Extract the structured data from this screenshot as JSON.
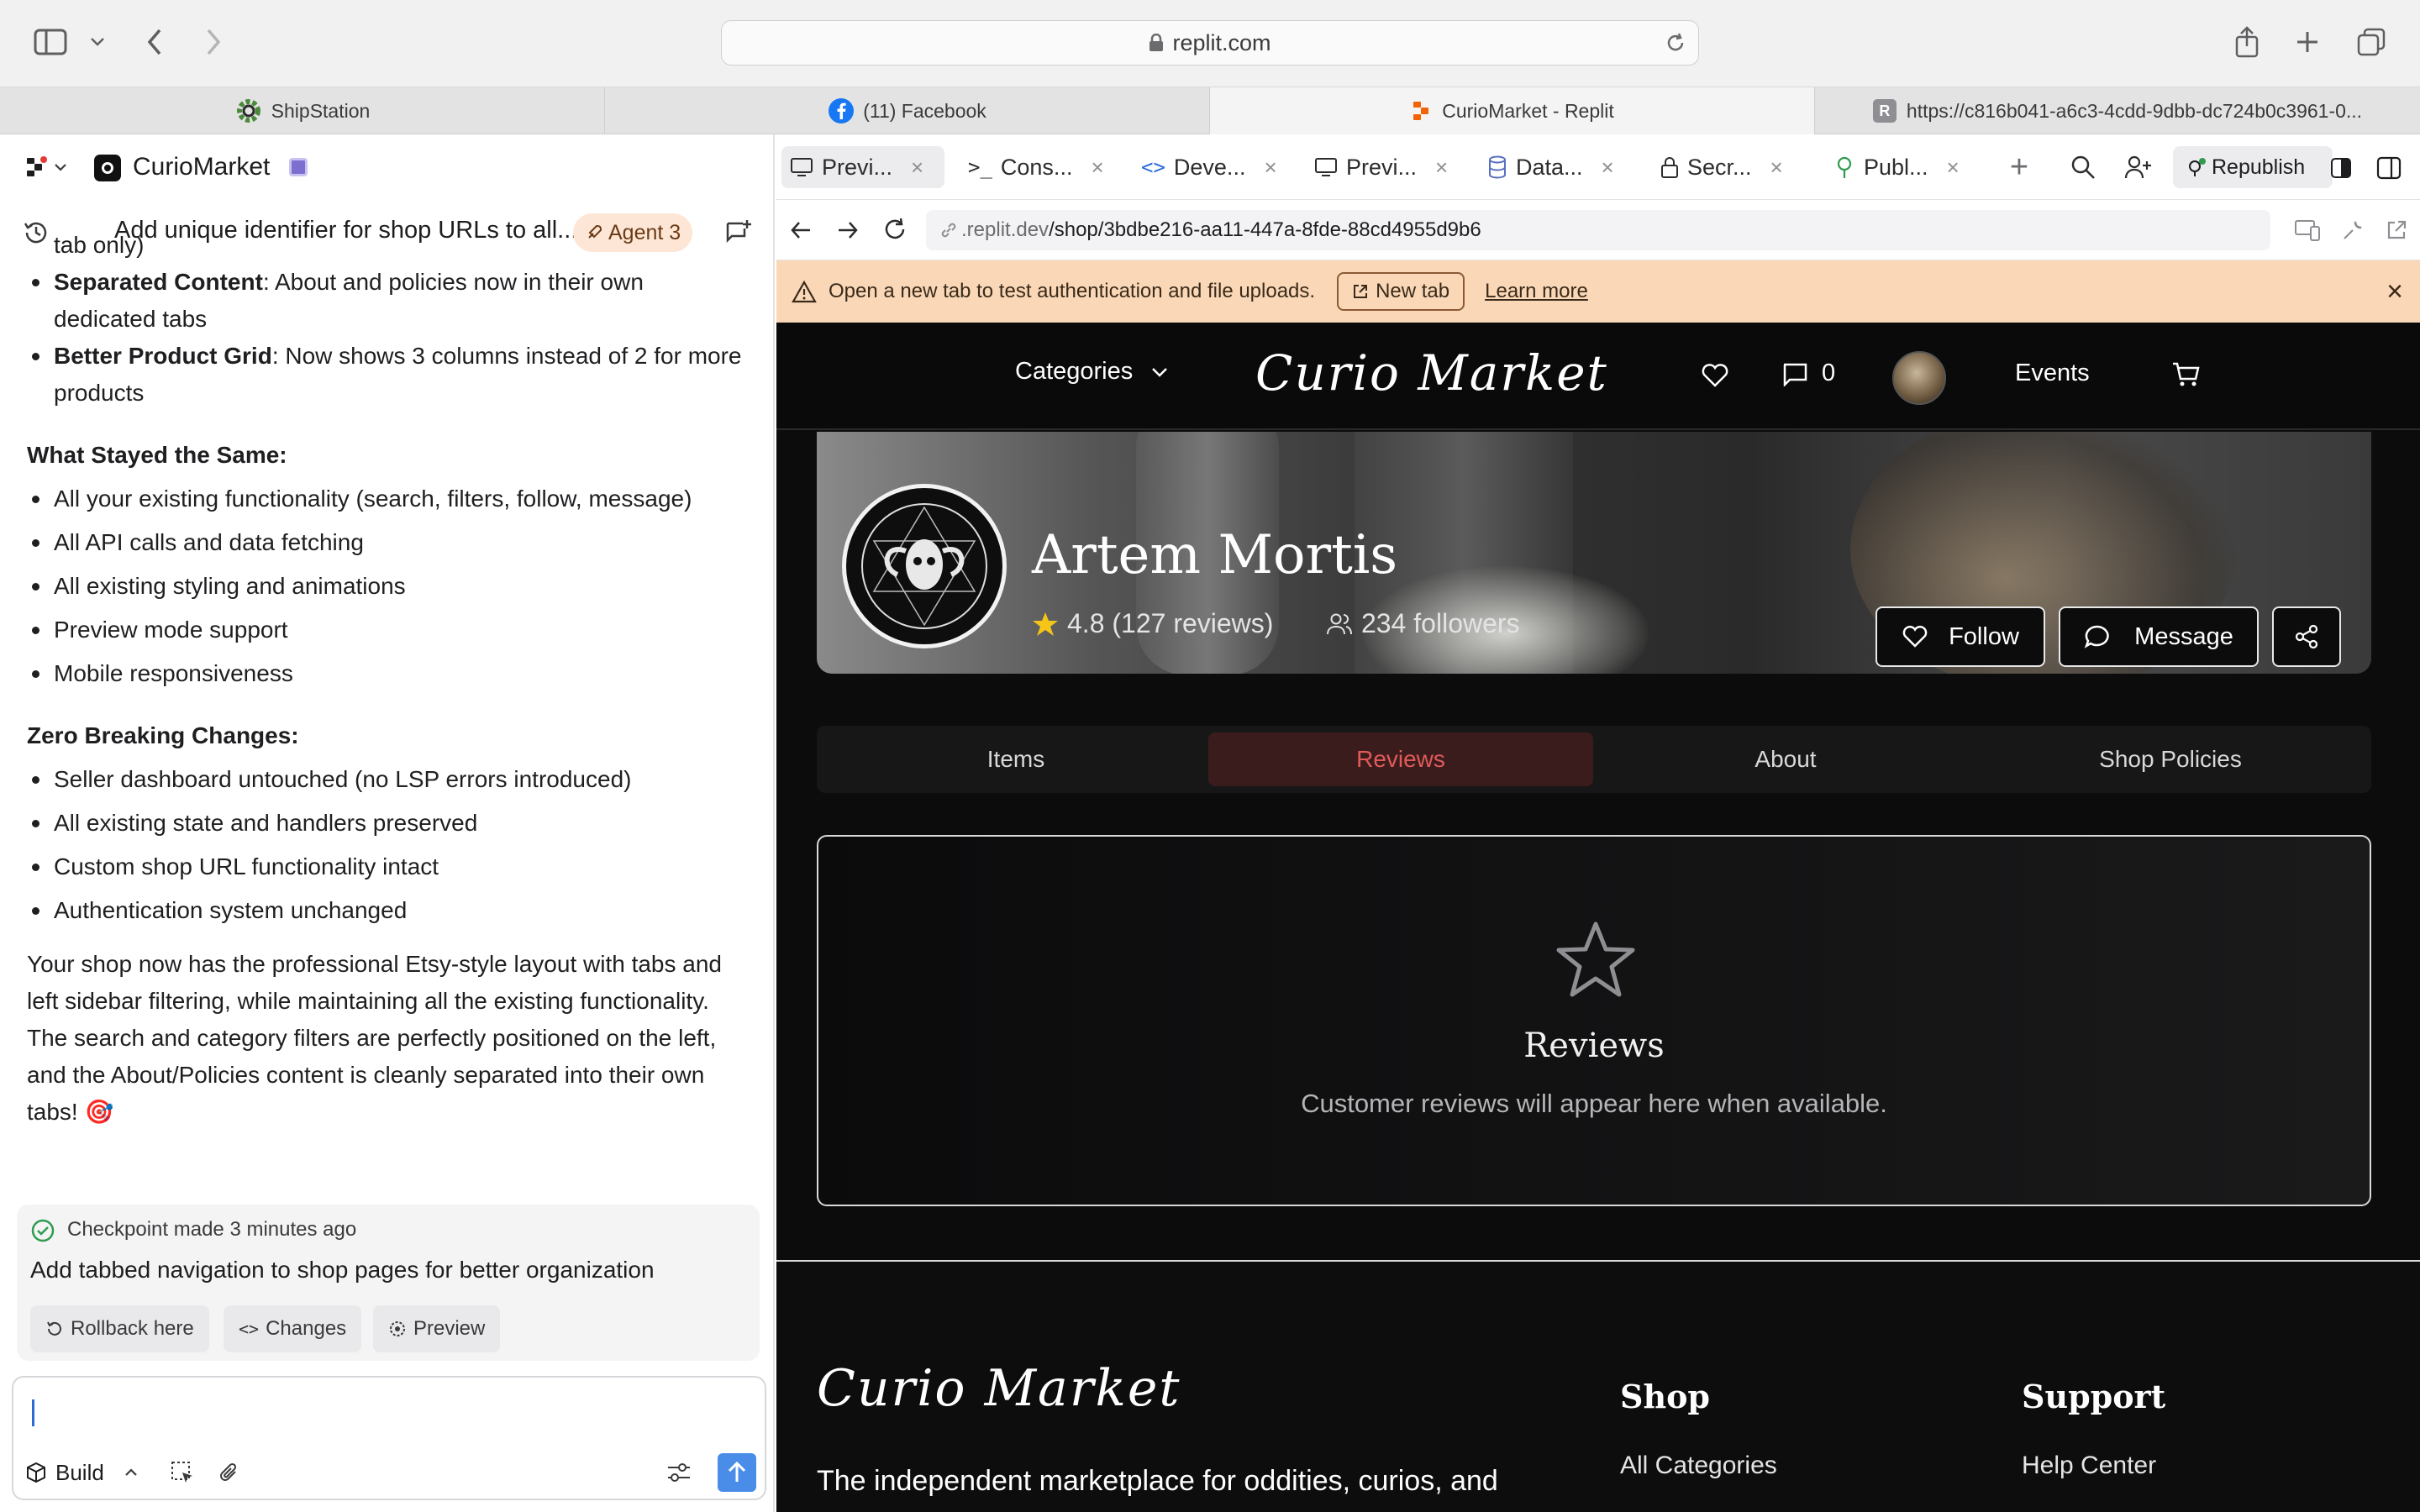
{
  "browser": {
    "address": "replit.com",
    "tabs": [
      {
        "label": "ShipStation"
      },
      {
        "label": "(11) Facebook"
      },
      {
        "label": "CurioMarket - Replit"
      },
      {
        "label": "https://c816b041-a6c3-4cdd-9dbb-dc724b0c3961-0..."
      }
    ]
  },
  "workspace": {
    "project_name": "CurioMarket",
    "thread_title": "Add unique identifier for shop URLs to all...",
    "agent_badge": "Agent 3"
  },
  "chat": {
    "fragment": "tab only)",
    "bullets_a": [
      {
        "bold": "Separated Content",
        "text": ": About and policies now in their own dedicated tabs"
      },
      {
        "bold": "Better Product Grid",
        "text": ": Now shows 3 columns instead of 2 for more products"
      }
    ],
    "heading_same": "What Stayed the Same:",
    "same_items": [
      "All your existing functionality (search, filters, follow, message)",
      "All API calls and data fetching",
      "All existing styling and animations",
      "Preview mode support",
      "Mobile responsiveness"
    ],
    "heading_zero": "Zero Breaking Changes:",
    "zero_items": [
      "Seller dashboard untouched (no LSP errors introduced)",
      "All existing state and handlers preserved",
      "Custom shop URL functionality intact",
      "Authentication system unchanged"
    ],
    "summary": "Your shop now has the professional Etsy-style layout with tabs and left sidebar filtering, while maintaining all the existing functionality. The search and category filters are perfectly positioned on the left, and the About/Policies content is cleanly separated into their own tabs! 🎯"
  },
  "checkpoint": {
    "status": "Checkpoint made 3 minutes ago",
    "message": "Add tabbed navigation to shop pages for better organization",
    "rollback": "Rollback here",
    "changes": "Changes",
    "preview": "Preview"
  },
  "composer": {
    "mode": "Build"
  },
  "pane_tabs": [
    {
      "label": "Previ..."
    },
    {
      "label": "Cons..."
    },
    {
      "label": "Deve..."
    },
    {
      "label": "Previ..."
    },
    {
      "label": "Data..."
    },
    {
      "label": "Secr..."
    },
    {
      "label": "Publ..."
    }
  ],
  "republish": "Republish",
  "preview_url": {
    "prefix": ".replit.dev",
    "path": "/shop/3bdbe216-aa11-447a-8fde-88cd4955d9b6"
  },
  "warning": {
    "text": "Open a new tab to test authentication and file uploads.",
    "new_tab": "New tab",
    "learn_more": "Learn more"
  },
  "site": {
    "categories": "Categories",
    "logo": "Curio Market",
    "messages_count": "0",
    "events": "Events",
    "shop_name": "Artem Mortis",
    "rating": "4.8 (127 reviews)",
    "followers": "234 followers",
    "follow": "Follow",
    "message": "Message",
    "tabs": [
      "Items",
      "Reviews",
      "About",
      "Shop Policies"
    ],
    "reviews_title": "Reviews",
    "reviews_empty": "Customer reviews will appear here when available.",
    "footer_tagline": "The independent marketplace for oddities, curios, and",
    "footer_shop": "Shop",
    "footer_support": "Support",
    "footer_all_categories": "All Categories",
    "footer_help": "Help Center"
  },
  "colors": {
    "accent_orange": "#f26207",
    "reviews_active": "#e05a5a",
    "warning_bg": "#fad8b7",
    "submit_blue": "#4a8de8"
  }
}
